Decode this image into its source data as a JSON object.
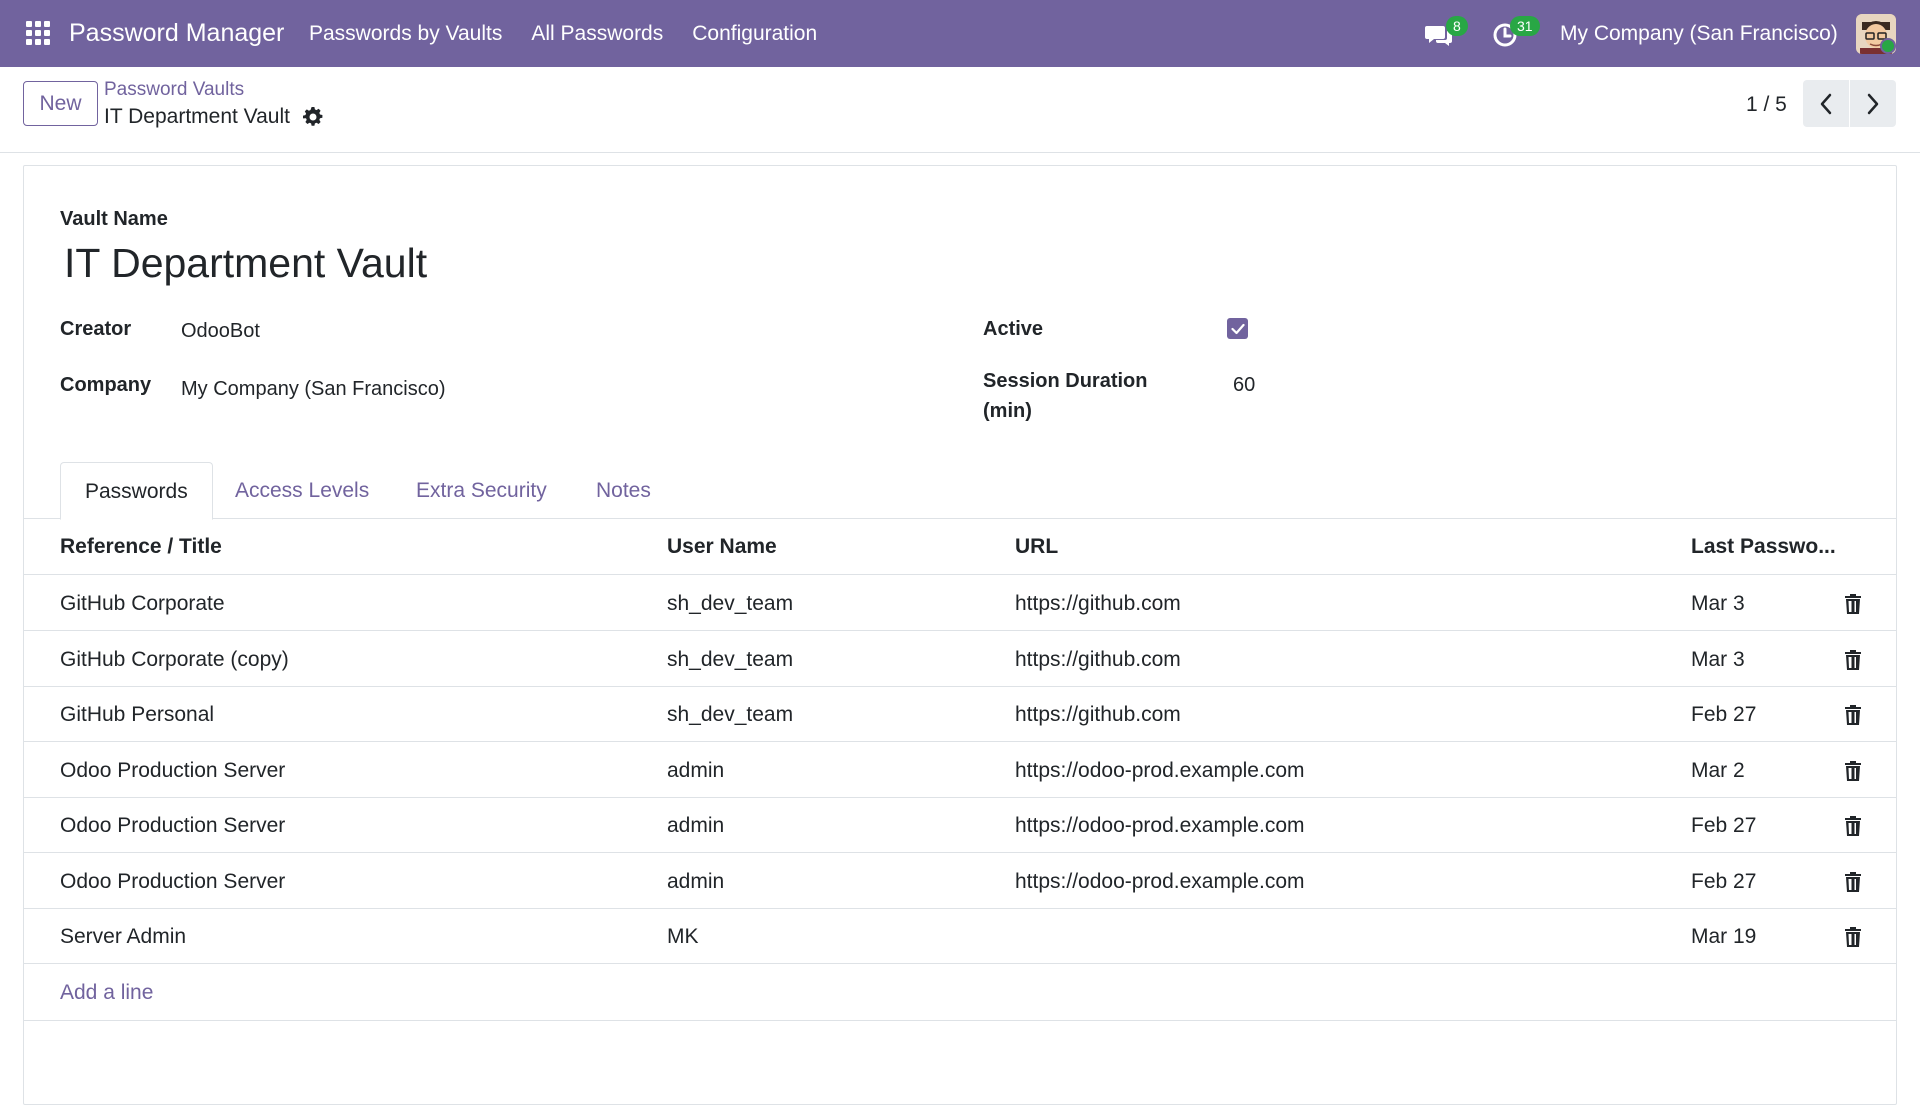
{
  "navbar": {
    "app_title": "Password Manager",
    "menu": [
      "Passwords by Vaults",
      "All Passwords",
      "Configuration"
    ],
    "messages_count": "8",
    "activities_count": "31",
    "company": "My Company (San Francisco)",
    "brand_color": "#71639e",
    "badge_color": "#28a745"
  },
  "control_panel": {
    "new_label": "New",
    "breadcrumb": "Password Vaults",
    "record_title": "IT Department Vault",
    "pager": "1 / 5"
  },
  "form": {
    "vault_name_label": "Vault Name",
    "vault_name": "IT Department Vault",
    "creator_label": "Creator",
    "creator": "OdooBot",
    "company_label": "Company",
    "company": "My Company (San Francisco)",
    "active_label": "Active",
    "active": true,
    "session_label_line1": "Session Duration",
    "session_label_line2": "(min)",
    "session_duration": "60"
  },
  "tabs": [
    "Passwords",
    "Access Levels",
    "Extra Security",
    "Notes"
  ],
  "table": {
    "headers": [
      "Reference / Title",
      "User Name",
      "URL",
      "Last Passwo..."
    ],
    "rows": [
      {
        "title": "GitHub Corporate",
        "user": "sh_dev_team",
        "url": "https://github.com",
        "last": "Mar 3"
      },
      {
        "title": "GitHub Corporate (copy)",
        "user": "sh_dev_team",
        "url": "https://github.com",
        "last": "Mar 3"
      },
      {
        "title": "GitHub Personal",
        "user": "sh_dev_team",
        "url": "https://github.com",
        "last": "Feb 27"
      },
      {
        "title": "Odoo Production Server",
        "user": "admin",
        "url": "https://odoo-prod.example.com",
        "last": "Mar 2"
      },
      {
        "title": "Odoo Production Server",
        "user": "admin",
        "url": "https://odoo-prod.example.com",
        "last": "Feb 27"
      },
      {
        "title": "Odoo Production Server",
        "user": "admin",
        "url": "https://odoo-prod.example.com",
        "last": "Feb 27"
      },
      {
        "title": "Server Admin",
        "user": "MK",
        "url": "",
        "last": "Mar 19"
      }
    ],
    "add_line": "Add a line"
  }
}
